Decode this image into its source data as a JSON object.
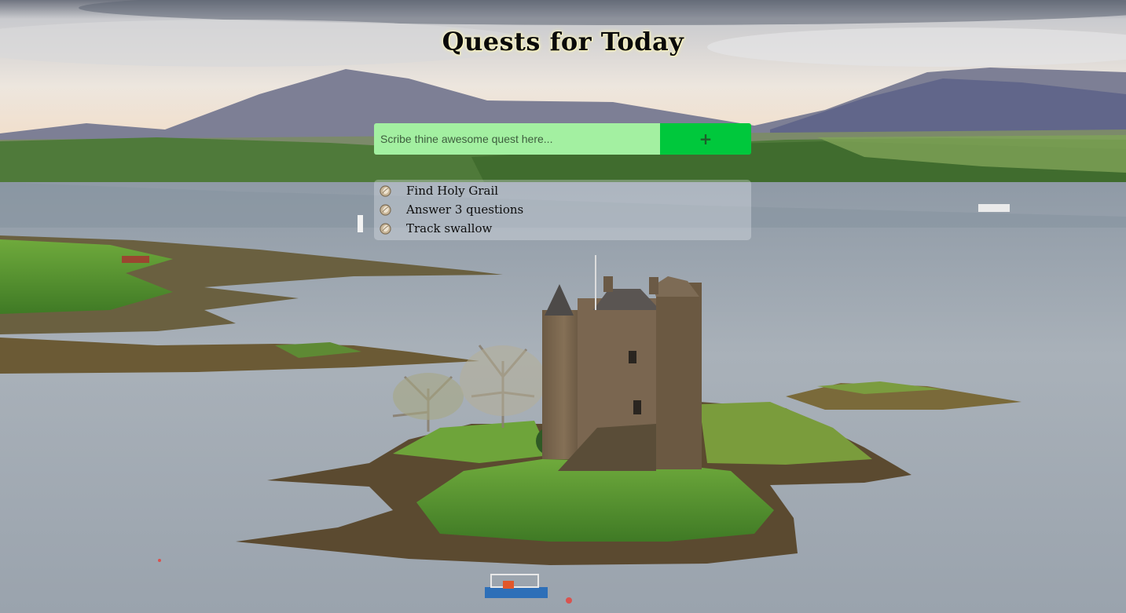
{
  "app": {
    "title": "Quests for Today"
  },
  "form": {
    "input_placeholder": "Scribe thine awesome quest here...",
    "input_value": "",
    "add_button_label": "+"
  },
  "quests": [
    {
      "text": "Find Holy Grail",
      "icon": "coin-icon"
    },
    {
      "text": "Answer 3 questions",
      "icon": "coin-icon"
    },
    {
      "text": "Track swallow",
      "icon": "coin-icon"
    }
  ],
  "colors": {
    "input_background": "#a3f0a1",
    "add_button_background": "#00c83c",
    "title_glow": "#fff6a8"
  }
}
